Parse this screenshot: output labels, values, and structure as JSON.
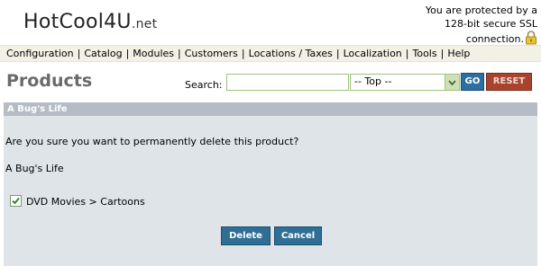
{
  "header": {
    "logo_main": "HotCool4U",
    "logo_tld": ".net",
    "ssl_line1": "You are protected by a",
    "ssl_line2": "128-bit secure SSL",
    "ssl_line3": "connection.",
    "lock_icon": "lock-icon"
  },
  "nav": {
    "items": [
      "Configuration",
      "Catalog",
      "Modules",
      "Customers",
      "Locations / Taxes",
      "Localization",
      "Tools",
      "Help"
    ]
  },
  "page": {
    "title": "Products"
  },
  "search": {
    "label": "Search:",
    "value": "",
    "category_selected": "-- Top --",
    "go_label": "GO",
    "reset_label": "RESET"
  },
  "panel": {
    "heading": "A Bug's Life",
    "question": "Are you sure you want to permanently delete this product?",
    "product_name": "A Bug's Life",
    "category_path": "DVD Movies > Cartoons",
    "category_checked": true,
    "delete_label": "Delete",
    "cancel_label": "Cancel"
  },
  "colors": {
    "nav_bg": "#f3f1e6",
    "panel_head": "#b5bcc5",
    "panel_bg": "#dfe4e8",
    "button_blue": "#2f6e95",
    "reset_red": "#a8432e",
    "field_border": "#9fc37a"
  }
}
